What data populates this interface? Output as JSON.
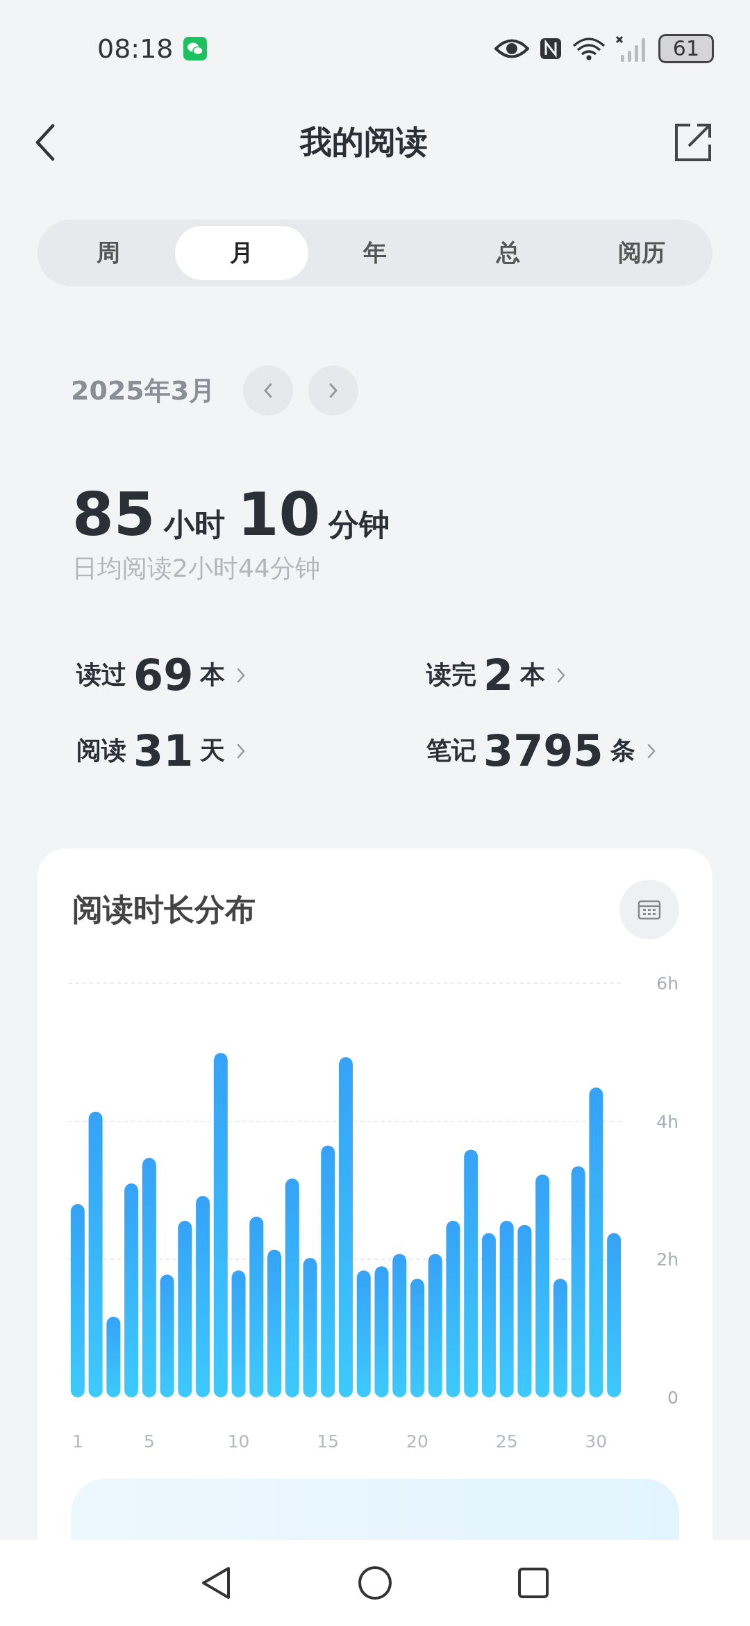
{
  "status_bar": {
    "time": "08:18",
    "battery": "61"
  },
  "header": {
    "title": "我的阅读"
  },
  "tabs": [
    {
      "label": "周",
      "selected": false
    },
    {
      "label": "月",
      "selected": true
    },
    {
      "label": "年",
      "selected": false
    },
    {
      "label": "总",
      "selected": false
    },
    {
      "label": "阅历",
      "selected": false
    }
  ],
  "period": {
    "label": "2025年3月"
  },
  "total": {
    "hours": "85",
    "hours_unit": "小时",
    "minutes": "10",
    "minutes_unit": "分钟",
    "daily_average": "日均阅读2小时44分钟"
  },
  "stats": [
    {
      "label": "读过",
      "value": "69",
      "unit": "本"
    },
    {
      "label": "读完",
      "value": "2",
      "unit": "本"
    },
    {
      "label": "阅读",
      "value": "31",
      "unit": "天"
    },
    {
      "label": "笔记",
      "value": "3795",
      "unit": "条"
    }
  ],
  "chart_card": {
    "title": "阅读时长分布",
    "chart_data": {
      "type": "bar",
      "x": [
        1,
        2,
        3,
        4,
        5,
        6,
        7,
        8,
        9,
        10,
        11,
        12,
        13,
        14,
        15,
        16,
        17,
        18,
        19,
        20,
        21,
        22,
        23,
        24,
        25,
        26,
        27,
        28,
        29,
        30,
        31
      ],
      "values": [
        2.8,
        4.14,
        1.17,
        3.1,
        3.47,
        1.78,
        2.56,
        2.92,
        4.99,
        1.84,
        2.62,
        2.14,
        3.17,
        2.02,
        3.65,
        4.93,
        1.84,
        1.9,
        2.08,
        1.72,
        2.08,
        2.56,
        3.59,
        2.38,
        2.56,
        2.5,
        3.23,
        1.72,
        3.35,
        4.49,
        2.38
      ],
      "ylim": [
        0,
        6
      ],
      "xlim": [
        0.5,
        31.5
      ],
      "xticks": [
        1,
        5,
        10,
        15,
        20,
        25,
        30
      ],
      "yticks": [
        {
          "value": 0,
          "label": "0"
        },
        {
          "value": 2,
          "label": "2h"
        },
        {
          "value": 4,
          "label": "4h"
        },
        {
          "value": 6,
          "label": "6h"
        }
      ]
    }
  }
}
